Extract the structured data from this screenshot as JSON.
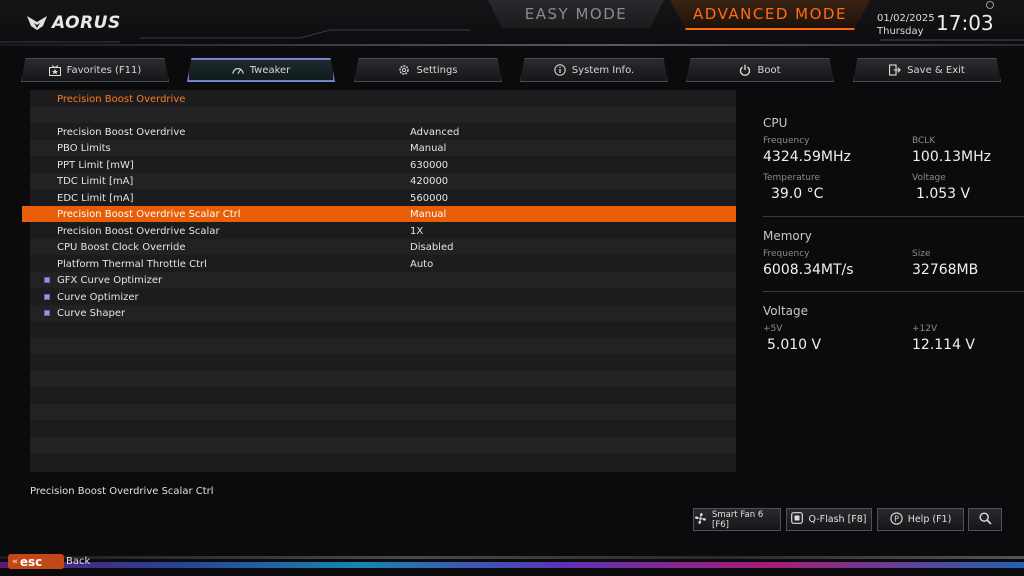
{
  "brand": {
    "logo_text": "AORUS"
  },
  "modes": {
    "easy": "EASY MODE",
    "advanced": "ADVANCED MODE"
  },
  "datetime": {
    "date": "01/02/2025",
    "day": "Thursday",
    "time": "17:03"
  },
  "tabs": [
    {
      "label": "Favorites (F11)",
      "icon": "favorites-icon"
    },
    {
      "label": "Tweaker",
      "icon": "gauge-icon",
      "active": true
    },
    {
      "label": "Settings",
      "icon": "gear-icon"
    },
    {
      "label": "System Info.",
      "icon": "info-icon"
    },
    {
      "label": "Boot",
      "icon": "power-icon"
    },
    {
      "label": "Save & Exit",
      "icon": "exit-icon"
    }
  ],
  "menu": {
    "header": "Precision Boost Overdrive",
    "items": [
      {
        "label": "Precision Boost Overdrive",
        "value": "Advanced"
      },
      {
        "label": "PBO Limits",
        "value": "Manual"
      },
      {
        "label": "PPT Limit [mW]",
        "value": "630000"
      },
      {
        "label": "TDC Limit [mA]",
        "value": "420000"
      },
      {
        "label": "EDC Limit [mA]",
        "value": "560000"
      },
      {
        "label": "Precision Boost Overdrive Scalar Ctrl",
        "value": "Manual",
        "selected": true
      },
      {
        "label": "Precision Boost Overdrive Scalar",
        "value": "1X"
      },
      {
        "label": "CPU Boost Clock Override",
        "value": "Disabled"
      },
      {
        "label": "Platform Thermal Throttle Ctrl",
        "value": "Auto"
      },
      {
        "label": "GFX Curve Optimizer",
        "value": "",
        "submenu": true
      },
      {
        "label": "Curve Optimizer",
        "value": "",
        "submenu": true
      },
      {
        "label": "Curve Shaper",
        "value": "",
        "submenu": true
      }
    ]
  },
  "hardware": {
    "cpu": {
      "title": "CPU",
      "frequency_label": "Frequency",
      "frequency": "4324.59MHz",
      "bclk_label": "BCLK",
      "bclk": "100.13MHz",
      "temperature_label": "Temperature",
      "temperature": "39.0 °C",
      "voltage_label": "Voltage",
      "voltage": "1.053 V"
    },
    "memory": {
      "title": "Memory",
      "frequency_label": "Frequency",
      "frequency": "6008.34MT/s",
      "size_label": "Size",
      "size": "32768MB"
    },
    "voltage": {
      "title": "Voltage",
      "v5_label": "+5V",
      "v5": "5.010 V",
      "v12_label": "+12V",
      "v12": "12.114 V"
    }
  },
  "description": "Precision Boost Overdrive Scalar Ctrl",
  "footer": {
    "smartfan": "Smart Fan 6 [F6]",
    "qflash": "Q-Flash [F8]",
    "help": "Help (F1)",
    "esc": "esc",
    "back": "Back"
  },
  "colors": {
    "accent": "#ff6a10",
    "selection": "#e85d08",
    "active_tab_border": "#2fb5c0"
  }
}
